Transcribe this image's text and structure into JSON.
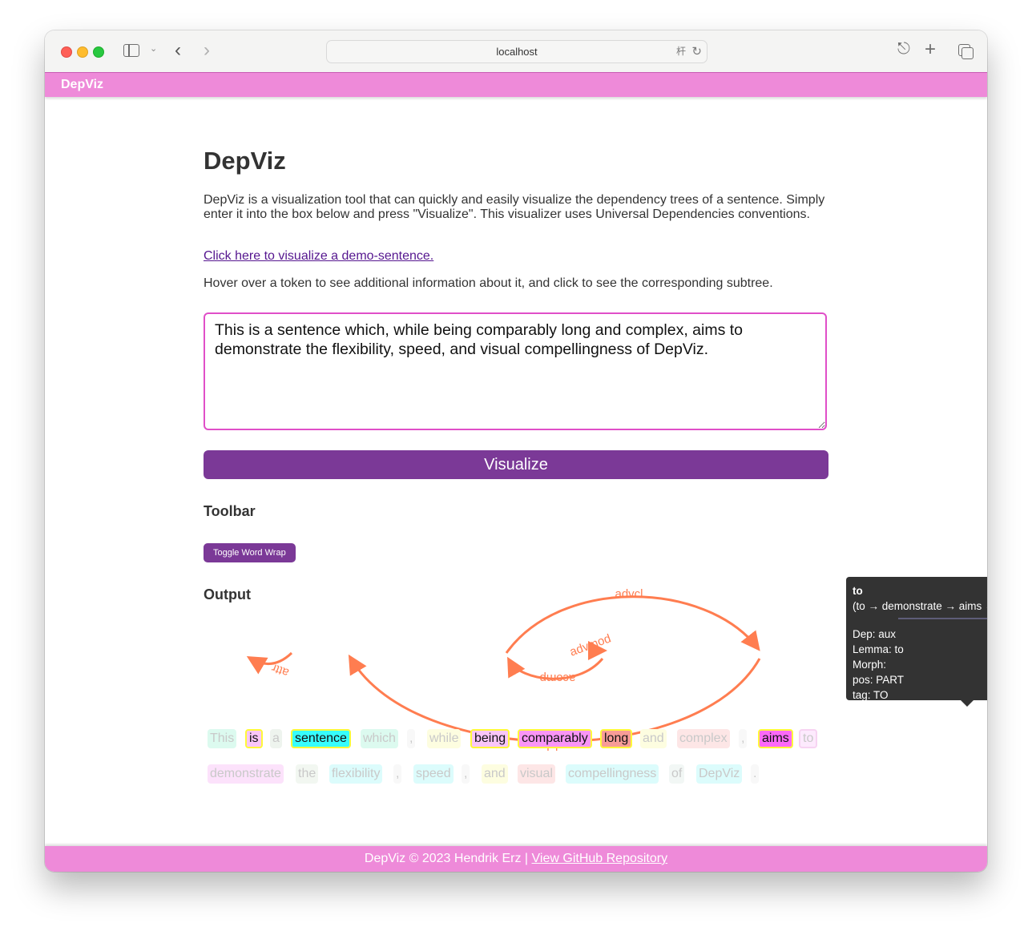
{
  "browser": {
    "address": "localhost",
    "icons": {
      "sidebar": "sidebar-toggle-icon",
      "back": "chevron-left-icon",
      "forward": "chevron-right-icon",
      "translate": "translate-icon",
      "reload": "reload-icon",
      "share": "share-icon",
      "new_tab": "plus-icon",
      "tabs": "tab-overview-icon"
    }
  },
  "header": {
    "brand": "DepViz"
  },
  "main": {
    "title": "DepViz",
    "intro": "DepViz is a visualization tool that can quickly and easily visualize the dependency trees of a sentence. Simply enter it into the box below and press \"Visualize\". This visualizer uses Universal Dependencies conventions.",
    "demo_link": "Click here to visualize a demo-sentence.",
    "hover_hint": "Hover over a token to see additional information about it, and click to see the corresponding subtree.",
    "sentence_input": "This is a sentence which, while being comparably long and complex, aims to demonstrate the flexibility, speed, and visual compellingness of DepViz.",
    "visualize_label": "Visualize",
    "toolbar_title": "Toolbar",
    "wrap_label": "Toggle Word Wrap",
    "output_title": "Output"
  },
  "output": {
    "arc_color": "#ff7d50",
    "highlight_border": "#fff93a",
    "tokens": [
      {
        "text": "This",
        "bg": "#dcfaef",
        "active": false,
        "row": 0
      },
      {
        "text": "is",
        "bg": "#f9c6f8",
        "active": true,
        "row": 0
      },
      {
        "text": "a",
        "bg": "#eef4ee",
        "active": false,
        "row": 0
      },
      {
        "text": "sentence",
        "bg": "#36fdfd",
        "active": true,
        "row": 0
      },
      {
        "text": "which",
        "bg": "#dcfaef",
        "active": false,
        "row": 0
      },
      {
        "text": ",",
        "bg": "#f8f8f8",
        "active": false,
        "row": 0
      },
      {
        "text": "while",
        "bg": "#fdfde0",
        "active": false,
        "row": 0
      },
      {
        "text": "being",
        "bg": "#f9c6f8",
        "active": true,
        "row": 0
      },
      {
        "text": "comparably",
        "bg": "#f995f6",
        "active": true,
        "row": 0
      },
      {
        "text": "long",
        "bg": "#f79c97",
        "active": true,
        "row": 0
      },
      {
        "text": "and",
        "bg": "#fdfde0",
        "active": false,
        "row": 0
      },
      {
        "text": "complex",
        "bg": "#fde6e6",
        "active": false,
        "row": 0
      },
      {
        "text": ",",
        "bg": "#f8f8f8",
        "active": false,
        "row": 0
      },
      {
        "text": "aims",
        "bg": "#fc69f8",
        "active": true,
        "row": 0
      },
      {
        "text": "to",
        "bg": "#fdeafd",
        "active": false,
        "hovered": true,
        "row": 0
      },
      {
        "text": "demonstrate",
        "bg": "#fce2fb",
        "active": false,
        "row": 1
      },
      {
        "text": "the",
        "bg": "#f2f7f1",
        "active": false,
        "row": 1
      },
      {
        "text": "flexibility",
        "bg": "#dcfcfc",
        "active": false,
        "row": 1
      },
      {
        "text": ",",
        "bg": "#f8f8f8",
        "active": false,
        "row": 1
      },
      {
        "text": "speed",
        "bg": "#dcfcfc",
        "active": false,
        "row": 1
      },
      {
        "text": ",",
        "bg": "#f8f8f8",
        "active": false,
        "row": 1
      },
      {
        "text": "and",
        "bg": "#fdfde0",
        "active": false,
        "row": 1
      },
      {
        "text": "visual",
        "bg": "#fde6e6",
        "active": false,
        "row": 1
      },
      {
        "text": "compellingness",
        "bg": "#dcfcfc",
        "active": false,
        "row": 1
      },
      {
        "text": "of",
        "bg": "#f2f7f5",
        "active": false,
        "row": 1
      },
      {
        "text": "DepViz",
        "bg": "#dcfcfc",
        "active": false,
        "row": 1
      },
      {
        "text": ".",
        "bg": "#f8f8f8",
        "active": false,
        "row": 1
      }
    ],
    "arcs": [
      {
        "label": "attr",
        "from": "sentence",
        "to": "is"
      },
      {
        "label": "advcl",
        "from": "being",
        "to": "aims"
      },
      {
        "label": "advmod",
        "from": "comparably",
        "to": "long"
      },
      {
        "label": "acomp",
        "from": "long",
        "to": "being"
      },
      {
        "label": "relcl",
        "from": "aims",
        "to": "sentence"
      }
    ],
    "tooltip": {
      "token": "to",
      "path": "(to → demonstrate → aims → sentence → is)",
      "dep": "Dep: aux",
      "lemma": "Lemma: to",
      "morph": "Morph:",
      "pos": "pos: PART",
      "tag": "tag: TO"
    }
  },
  "footer": {
    "text": "DepViz © 2023 Hendrik Erz | ",
    "link": "View GitHub Repository"
  }
}
